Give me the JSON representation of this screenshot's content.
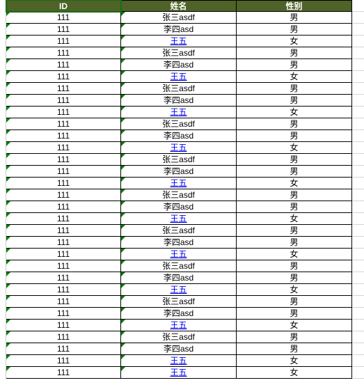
{
  "table": {
    "headers": [
      "ID",
      "姓名",
      "性别"
    ],
    "rows": [
      {
        "id": "111",
        "name": "张三asdf",
        "gender": "男",
        "name_link": false
      },
      {
        "id": "111",
        "name": "李四asd",
        "gender": "男",
        "name_link": false
      },
      {
        "id": "111",
        "name": "王五",
        "gender": "女",
        "name_link": true
      },
      {
        "id": "111",
        "name": "张三asdf",
        "gender": "男",
        "name_link": false
      },
      {
        "id": "111",
        "name": "李四asd",
        "gender": "男",
        "name_link": false
      },
      {
        "id": "111",
        "name": "王五",
        "gender": "女",
        "name_link": true
      },
      {
        "id": "111",
        "name": "张三asdf",
        "gender": "男",
        "name_link": false
      },
      {
        "id": "111",
        "name": "李四asd",
        "gender": "男",
        "name_link": false
      },
      {
        "id": "111",
        "name": "王五",
        "gender": "女",
        "name_link": true
      },
      {
        "id": "111",
        "name": "张三asdf",
        "gender": "男",
        "name_link": false
      },
      {
        "id": "111",
        "name": "李四asd",
        "gender": "男",
        "name_link": false
      },
      {
        "id": "111",
        "name": "王五",
        "gender": "女",
        "name_link": true
      },
      {
        "id": "111",
        "name": "张三asdf",
        "gender": "男",
        "name_link": false
      },
      {
        "id": "111",
        "name": "李四asd",
        "gender": "男",
        "name_link": false
      },
      {
        "id": "111",
        "name": "王五",
        "gender": "女",
        "name_link": true
      },
      {
        "id": "111",
        "name": "张三asdf",
        "gender": "男",
        "name_link": false
      },
      {
        "id": "111",
        "name": "李四asd",
        "gender": "男",
        "name_link": false
      },
      {
        "id": "111",
        "name": "王五",
        "gender": "女",
        "name_link": true
      },
      {
        "id": "111",
        "name": "张三asdf",
        "gender": "男",
        "name_link": false
      },
      {
        "id": "111",
        "name": "李四asd",
        "gender": "男",
        "name_link": false
      },
      {
        "id": "111",
        "name": "王五",
        "gender": "女",
        "name_link": true
      },
      {
        "id": "111",
        "name": "张三asdf",
        "gender": "男",
        "name_link": false
      },
      {
        "id": "111",
        "name": "李四asd",
        "gender": "男",
        "name_link": false
      },
      {
        "id": "111",
        "name": "王五",
        "gender": "女",
        "name_link": true
      },
      {
        "id": "111",
        "name": "张三asdf",
        "gender": "男",
        "name_link": false
      },
      {
        "id": "111",
        "name": "李四asd",
        "gender": "男",
        "name_link": false
      },
      {
        "id": "111",
        "name": "王五",
        "gender": "女",
        "name_link": true
      },
      {
        "id": "111",
        "name": "张三asdf",
        "gender": "男",
        "name_link": false
      },
      {
        "id": "111",
        "name": "李四asd",
        "gender": "男",
        "name_link": false
      },
      {
        "id": "111",
        "name": "王五",
        "gender": "女",
        "name_link": true
      },
      {
        "id": "111",
        "name": "王五",
        "gender": "女",
        "name_link": true
      }
    ],
    "selected_cell": {
      "row": -1,
      "col": 0
    }
  }
}
